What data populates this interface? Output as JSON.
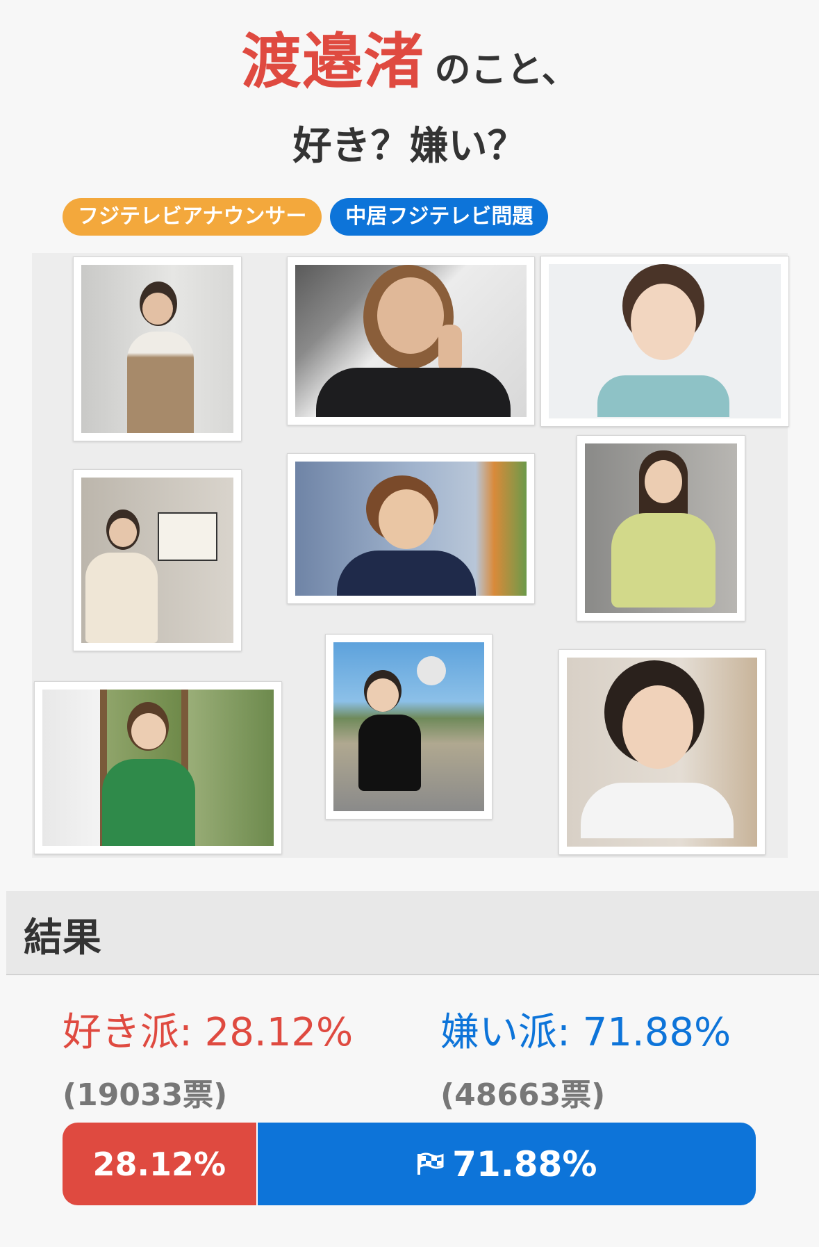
{
  "title": {
    "name": "渡邉渚",
    "suffix": "のこと、",
    "question": "好き？嫌い？"
  },
  "tags": [
    {
      "label": "フジテレビアナウンサー",
      "color": "#f3a83c"
    },
    {
      "label": "中居フジテレビ問題",
      "color": "#0d74d9"
    }
  ],
  "colors": {
    "like": "#df4a40",
    "dislike": "#0d74d9"
  },
  "results": {
    "header": "結果",
    "like": {
      "label": "好き派: 28.12%",
      "votes": "(19033票)",
      "bar_label": "28.12%",
      "percent": 28.12
    },
    "dislike": {
      "label": "嫌い派: 71.88%",
      "votes": "(48663票)",
      "bar_label": "71.88%",
      "percent": 71.88,
      "icon": "flag-icon"
    }
  }
}
